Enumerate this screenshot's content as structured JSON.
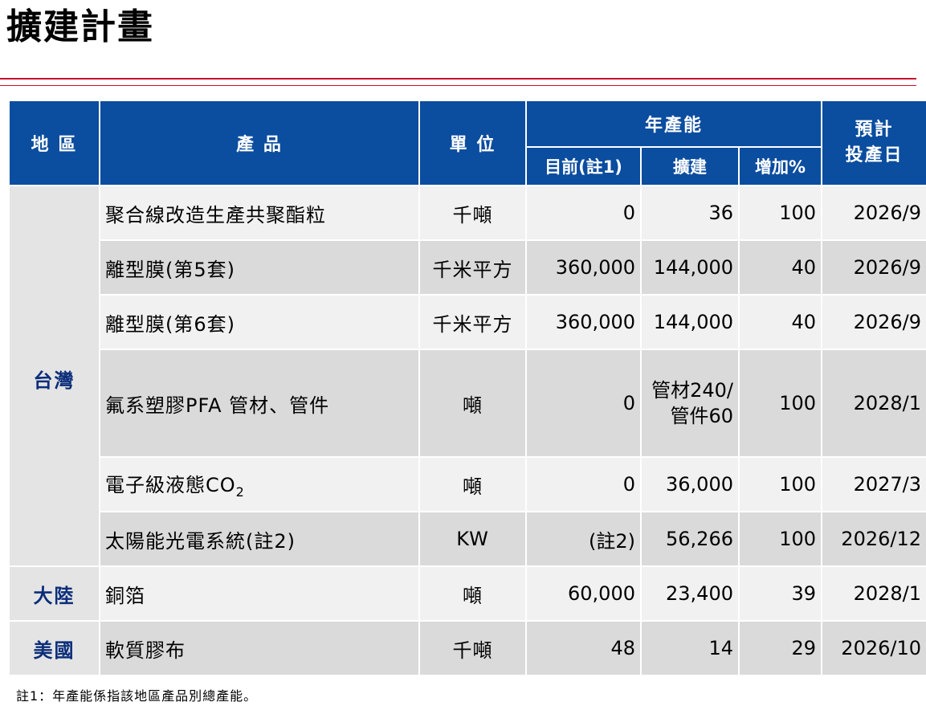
{
  "page": {
    "title": "擴建計畫",
    "footnote": "註1：年產能係指該地區產品別總產能。"
  },
  "header": {
    "region": "地 區",
    "product": "產 品",
    "unit": "單 位",
    "capacity": "年產能",
    "current": "目前(註1)",
    "expansion": "擴建",
    "increase": "增加%",
    "expected_line1": "預計",
    "expected_line2": "投產日"
  },
  "regions": {
    "taiwan": "台灣",
    "mainland": "大陸",
    "usa": "美國"
  },
  "rows": [
    {
      "product": "聚合線改造生產共聚酯粒",
      "unit": "千噸",
      "current": "0",
      "expansion": "36",
      "increase": "100",
      "date": "2026/9"
    },
    {
      "product": "離型膜(第5套)",
      "unit": "千米平方",
      "current": "360,000",
      "expansion": "144,000",
      "increase": "40",
      "date": "2026/9"
    },
    {
      "product": "離型膜(第6套)",
      "unit": "千米平方",
      "current": "360,000",
      "expansion": "144,000",
      "increase": "40",
      "date": "2026/9"
    },
    {
      "product": "氟系塑膠PFA 管材、管件",
      "unit": "噸",
      "current": "0",
      "expansion_line1": "管材240/",
      "expansion_line2": "管件60",
      "increase": "100",
      "date": "2028/1"
    },
    {
      "product_prefix": "電子級液態CO",
      "product_sub": "2",
      "unit": "噸",
      "current": "0",
      "expansion": "36,000",
      "increase": "100",
      "date": "2027/3"
    },
    {
      "product": "太陽能光電系統(註2)",
      "unit": "KW",
      "current": "(註2)",
      "expansion": "56,266",
      "increase": "100",
      "date": "2026/12"
    },
    {
      "product": "銅箔",
      "unit": "噸",
      "current": "60,000",
      "expansion": "23,400",
      "increase": "39",
      "date": "2028/1"
    },
    {
      "product": "軟質膠布",
      "unit": "千噸",
      "current": "48",
      "expansion": "14",
      "increase": "29",
      "date": "2026/10"
    }
  ]
}
